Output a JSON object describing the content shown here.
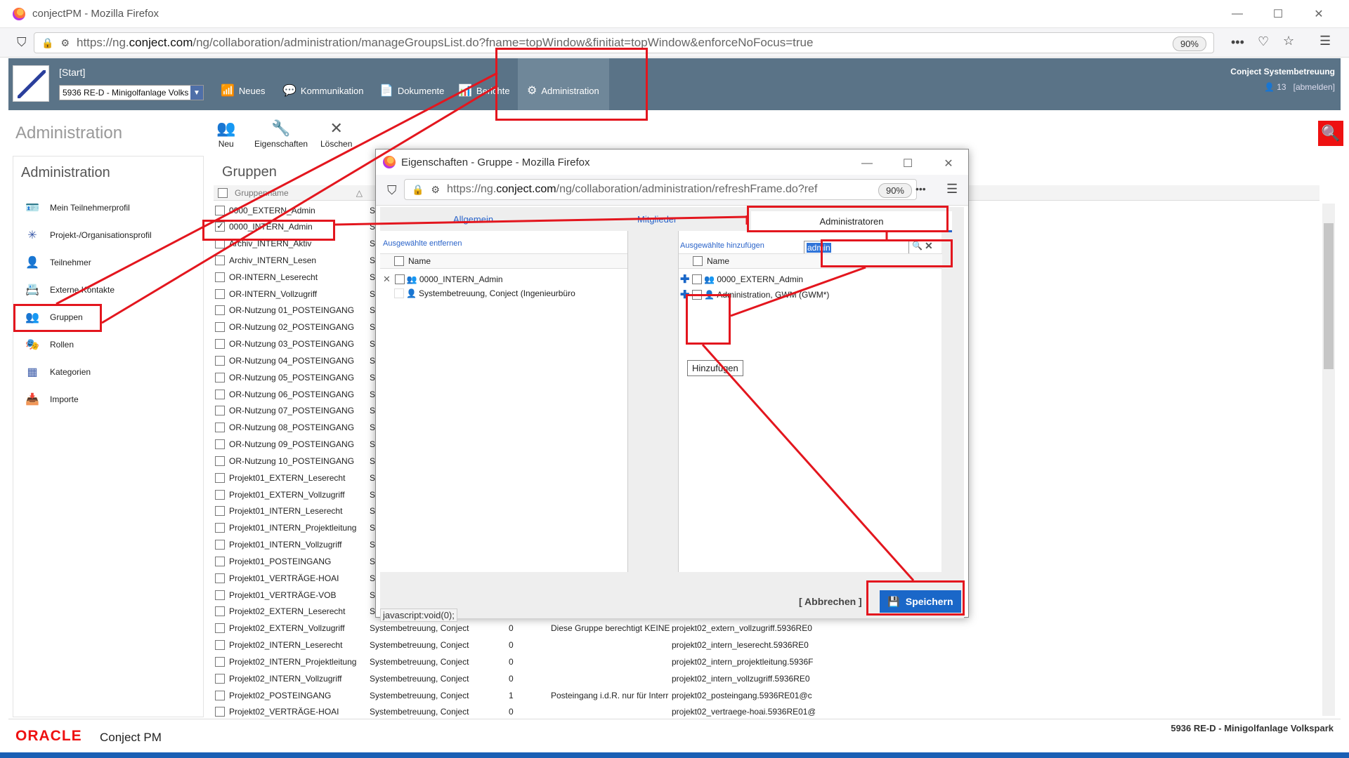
{
  "browser": {
    "title": "conjectPM - Mozilla Firefox",
    "url_pre": "https://ng.",
    "url_host": "conject.com",
    "url_post": "/ng/collaboration/administration/manageGroupsList.do?fname=topWindow&finitiat=topWindow&enforceNoFocus=true",
    "zoom": "90%",
    "min": "—",
    "max": "☐",
    "close": "✕",
    "dots": "•••",
    "menu": "☰"
  },
  "header": {
    "start": "[Start]",
    "project": "5936 RE-D - Minigolfanlage Volks",
    "nav": [
      "Neues",
      "Kommunikation",
      "Dokumente",
      "Berichte",
      "Administration"
    ],
    "user": "Conject Systembetreuung",
    "user_count": "13",
    "logout": "[abmelden]"
  },
  "page_title": "Administration",
  "toolbar": [
    "Neu",
    "Eigenschaften",
    "Löschen"
  ],
  "sidebar": {
    "title": "Administration",
    "items": [
      "Mein Teilnehmerprofil",
      "Projekt-/Organisationsprofil",
      "Teilnehmer",
      "Externe Kontakte",
      "Gruppen",
      "Rollen",
      "Kategorien",
      "Importe"
    ]
  },
  "groups": {
    "title": "Gruppen",
    "col_name": "Gruppenname",
    "rows": [
      {
        "n": "0000_EXTERN_Admin",
        "c2": "Sy",
        "c3": "",
        "c4": "",
        "c5": "",
        "checked": false
      },
      {
        "n": "0000_INTERN_Admin",
        "c2": "Sy",
        "c3": "",
        "c4": "",
        "c5": "",
        "checked": true
      },
      {
        "n": "Archiv_INTERN_Aktiv",
        "c2": "Sy",
        "c3": "",
        "c4": "",
        "c5": "",
        "checked": false
      },
      {
        "n": "Archiv_INTERN_Lesen",
        "c2": "Sy",
        "c3": "",
        "c4": "",
        "c5": "",
        "checked": false
      },
      {
        "n": "OR-INTERN_Leserecht",
        "c2": "Sy",
        "c3": "",
        "c4": "",
        "c5": "",
        "checked": false
      },
      {
        "n": "OR-INTERN_Vollzugriff",
        "c2": "Sy",
        "c3": "",
        "c4": "",
        "c5": "",
        "checked": false
      },
      {
        "n": "OR-Nutzung 01_POSTEINGANG",
        "c2": "Sy",
        "c3": "",
        "c4": "",
        "c5": "",
        "checked": false
      },
      {
        "n": "OR-Nutzung 02_POSTEINGANG",
        "c2": "Sy",
        "c3": "",
        "c4": "",
        "c5": "",
        "checked": false
      },
      {
        "n": "OR-Nutzung 03_POSTEINGANG",
        "c2": "Sy",
        "c3": "",
        "c4": "",
        "c5": "",
        "checked": false
      },
      {
        "n": "OR-Nutzung 04_POSTEINGANG",
        "c2": "Sy",
        "c3": "",
        "c4": "",
        "c5": "",
        "checked": false
      },
      {
        "n": "OR-Nutzung 05_POSTEINGANG",
        "c2": "Sy",
        "c3": "",
        "c4": "",
        "c5": "",
        "checked": false
      },
      {
        "n": "OR-Nutzung 06_POSTEINGANG",
        "c2": "Sy",
        "c3": "",
        "c4": "",
        "c5": "",
        "checked": false
      },
      {
        "n": "OR-Nutzung 07_POSTEINGANG",
        "c2": "Sy",
        "c3": "",
        "c4": "",
        "c5": "",
        "checked": false
      },
      {
        "n": "OR-Nutzung 08_POSTEINGANG",
        "c2": "Sy",
        "c3": "",
        "c4": "",
        "c5": "",
        "checked": false
      },
      {
        "n": "OR-Nutzung 09_POSTEINGANG",
        "c2": "Sy",
        "c3": "",
        "c4": "",
        "c5": "",
        "checked": false
      },
      {
        "n": "OR-Nutzung 10_POSTEINGANG",
        "c2": "Sy",
        "c3": "",
        "c4": "",
        "c5": "",
        "checked": false
      },
      {
        "n": "Projekt01_EXTERN_Leserecht",
        "c2": "Sy",
        "c3": "",
        "c4": "",
        "c5": "",
        "checked": false
      },
      {
        "n": "Projekt01_EXTERN_Vollzugriff",
        "c2": "Sy",
        "c3": "",
        "c4": "",
        "c5": "",
        "checked": false
      },
      {
        "n": "Projekt01_INTERN_Leserecht",
        "c2": "Sy",
        "c3": "",
        "c4": "",
        "c5": "",
        "checked": false
      },
      {
        "n": "Projekt01_INTERN_Projektleitung",
        "c2": "Sy",
        "c3": "",
        "c4": "",
        "c5": "",
        "checked": false
      },
      {
        "n": "Projekt01_INTERN_Vollzugriff",
        "c2": "Sy",
        "c3": "",
        "c4": "",
        "c5": "",
        "checked": false
      },
      {
        "n": "Projekt01_POSTEINGANG",
        "c2": "Sy",
        "c3": "",
        "c4": "",
        "c5": "",
        "checked": false
      },
      {
        "n": "Projekt01_VERTRÄGE-HOAI",
        "c2": "Sy",
        "c3": "",
        "c4": "",
        "c5": "",
        "checked": false
      },
      {
        "n": "Projekt01_VERTRÄGE-VOB",
        "c2": "Sy",
        "c3": "",
        "c4": "",
        "c5": "",
        "checked": false
      },
      {
        "n": "Projekt02_EXTERN_Leserecht",
        "c2": "Sy",
        "c3": "",
        "c4": "",
        "c5": "",
        "checked": false
      },
      {
        "n": "Projekt02_EXTERN_Vollzugriff",
        "c2": "Systembetreuung, Conject",
        "c3": "0",
        "c4": "Diese Gruppe berechtigt KEINE",
        "c5": "projekt02_extern_vollzugriff.5936RE0",
        "checked": false
      },
      {
        "n": "Projekt02_INTERN_Leserecht",
        "c2": "Systembetreuung, Conject",
        "c3": "0",
        "c4": "",
        "c5": "projekt02_intern_leserecht.5936RE0",
        "checked": false
      },
      {
        "n": "Projekt02_INTERN_Projektleitung",
        "c2": "Systembetreuung, Conject",
        "c3": "0",
        "c4": "",
        "c5": "projekt02_intern_projektleitung.5936F",
        "checked": false
      },
      {
        "n": "Projekt02_INTERN_Vollzugriff",
        "c2": "Systembetreuung, Conject",
        "c3": "0",
        "c4": "",
        "c5": "projekt02_intern_vollzugriff.5936RE0",
        "checked": false
      },
      {
        "n": "Projekt02_POSTEINGANG",
        "c2": "Systembetreuung, Conject",
        "c3": "1",
        "c4": "Posteingang i.d.R. nur für Interr",
        "c5": "projekt02_posteingang.5936RE01@c",
        "checked": false
      },
      {
        "n": "Projekt02_VERTRÄGE-HOAI",
        "c2": "Systembetreuung, Conject",
        "c3": "0",
        "c4": "",
        "c5": "projekt02_vertraege-hoai.5936RE01@",
        "checked": false
      }
    ]
  },
  "footer": {
    "brand": "ORACLE",
    "product": "Conject PM",
    "project": "5936 RE-D - Minigolfanlage Volkspark"
  },
  "popup": {
    "title": "Eigenschaften - Gruppe - Mozilla Firefox",
    "url_pre": "https://ng.",
    "url_host": "conject.com",
    "url_post": "/ng/collaboration/administration/refreshFrame.do?ref",
    "zoom": "90%",
    "tabs": [
      "Allgemein",
      "Mitglieder",
      "Administratoren"
    ],
    "remove_selected": "Ausgewählte entfernen",
    "add_selected": "Ausgewählte hinzufügen",
    "col_name": "Name",
    "left_items": [
      "0000_INTERN_Admin",
      "Systembetreuung, Conject (Ingenieurbüro"
    ],
    "right_items": [
      "0000_EXTERN_Admin",
      "Administration, GWM (GWM*)"
    ],
    "search_value": "admin",
    "tooltip": "Hinzufügen",
    "status": "javascript:void(0);",
    "cancel": "[ Abbrechen ]",
    "save": "Speichern"
  },
  "colors": {
    "accent": "#5a7387",
    "annotation": "#e3161e",
    "save": "#1a67c8"
  }
}
